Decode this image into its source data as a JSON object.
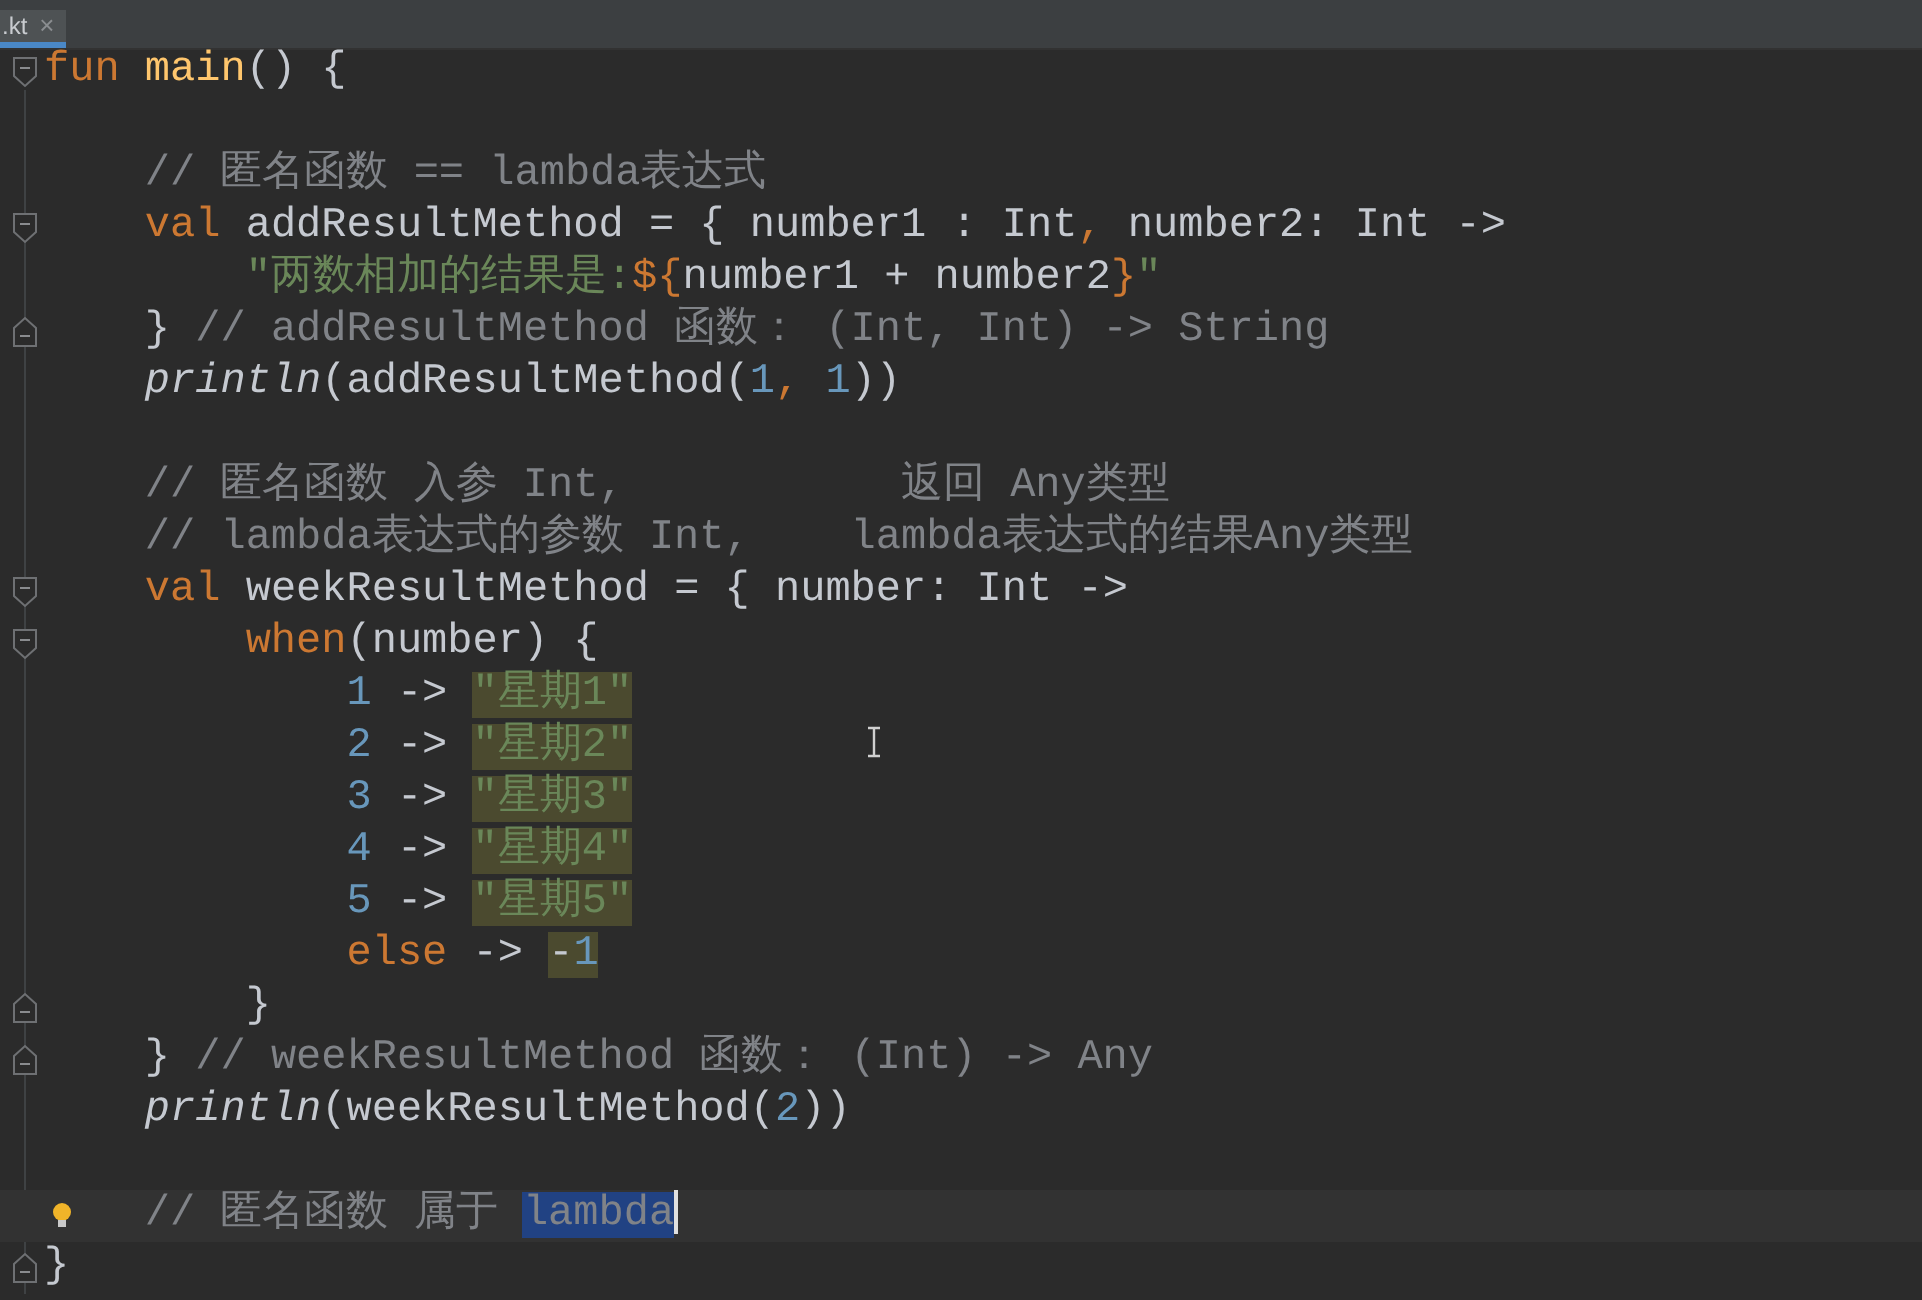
{
  "tab": {
    "label": ".kt",
    "close": "×",
    "selected": true
  },
  "lines": [
    {
      "current": false,
      "gutter": {
        "kind": "fold-open"
      },
      "tokens": [
        {
          "kind": "kw",
          "t": "fun "
        },
        {
          "kind": "fn",
          "t": "main"
        },
        {
          "kind": "p",
          "t": "() {"
        }
      ]
    },
    {
      "current": false,
      "gap_above": true,
      "tokens": [
        {
          "kind": "cm",
          "t": "    // 匿名函数 == lambda表达式"
        }
      ]
    },
    {
      "current": false,
      "gutter": {
        "kind": "fold-open"
      },
      "tokens": [
        {
          "kind": "kw",
          "t": "    val "
        },
        {
          "kind": "p",
          "t": "addResultMethod = { number1 : Int"
        },
        {
          "kind": "comma",
          "t": ","
        },
        {
          "kind": "p",
          "t": " number2: Int ->"
        }
      ]
    },
    {
      "current": false,
      "tokens": [
        {
          "kind": "str",
          "t": "        \"两数相加的结果是:"
        },
        {
          "kind": "tpl",
          "t": "${"
        },
        {
          "kind": "p",
          "t": "number1 + number2"
        },
        {
          "kind": "tpl",
          "t": "}"
        },
        {
          "kind": "str",
          "t": "\""
        }
      ]
    },
    {
      "current": false,
      "gutter": {
        "kind": "fold-close"
      },
      "tokens": [
        {
          "kind": "p",
          "t": "    }"
        },
        {
          "kind": "cm",
          "t": " // addResultMethod 函数： (Int, Int) -> String"
        }
      ]
    },
    {
      "current": false,
      "tokens": [
        {
          "kind": "call",
          "t": "    println"
        },
        {
          "kind": "p",
          "t": "(addResultMethod("
        },
        {
          "kind": "num",
          "t": "1"
        },
        {
          "kind": "comma",
          "t": ","
        },
        {
          "kind": "num",
          "t": " 1"
        },
        {
          "kind": "p",
          "t": "))"
        }
      ]
    },
    {
      "current": false,
      "gap_above": true,
      "tokens": [
        {
          "kind": "cm",
          "t": "    // 匿名函数 入参 Int,           返回 Any类型"
        }
      ]
    },
    {
      "current": false,
      "tokens": [
        {
          "kind": "cm",
          "t": "    // lambda表达式的参数 Int,    lambda表达式的结果Any类型"
        }
      ]
    },
    {
      "current": false,
      "gutter": {
        "kind": "fold-open"
      },
      "tokens": [
        {
          "kind": "kw",
          "t": "    val "
        },
        {
          "kind": "p",
          "t": "weekResultMethod = { number: Int ->"
        }
      ]
    },
    {
      "current": false,
      "gutter": {
        "kind": "fold-open"
      },
      "tokens": [
        {
          "kind": "kw",
          "t": "        when"
        },
        {
          "kind": "p",
          "t": "(number) {"
        }
      ]
    },
    {
      "current": false,
      "tokens": [
        {
          "kind": "num",
          "t": "            1"
        },
        {
          "kind": "p",
          "t": " -> "
        },
        {
          "kind": "str",
          "t": "\"星期1\"",
          "hl": {
            "kind": "match"
          }
        }
      ]
    },
    {
      "current": false,
      "tokens": [
        {
          "kind": "num",
          "t": "            2"
        },
        {
          "kind": "p",
          "t": " -> "
        },
        {
          "kind": "str",
          "t": "\"星期2\"",
          "hl": {
            "kind": "match"
          }
        }
      ]
    },
    {
      "current": false,
      "tokens": [
        {
          "kind": "num",
          "t": "            3"
        },
        {
          "kind": "p",
          "t": " -> "
        },
        {
          "kind": "str",
          "t": "\"星期3\"",
          "hl": {
            "kind": "match"
          }
        }
      ]
    },
    {
      "current": false,
      "tokens": [
        {
          "kind": "num",
          "t": "            4"
        },
        {
          "kind": "p",
          "t": " -> "
        },
        {
          "kind": "str",
          "t": "\"星期4\"",
          "hl": {
            "kind": "match"
          }
        }
      ]
    },
    {
      "current": false,
      "tokens": [
        {
          "kind": "num",
          "t": "            5"
        },
        {
          "kind": "p",
          "t": " -> "
        },
        {
          "kind": "str",
          "t": "\"星期5\"",
          "hl": {
            "kind": "match"
          }
        }
      ]
    },
    {
      "current": false,
      "tokens": [
        {
          "kind": "kw",
          "t": "            else"
        },
        {
          "kind": "p",
          "t": " -> "
        },
        {
          "kind": "p",
          "t": "-",
          "hl": {
            "kind": "match"
          }
        },
        {
          "kind": "num",
          "t": "1",
          "hl": {
            "kind": "match"
          }
        }
      ]
    },
    {
      "current": false,
      "gutter": {
        "kind": "fold-close"
      },
      "tokens": [
        {
          "kind": "p",
          "t": "        }"
        }
      ]
    },
    {
      "current": false,
      "gutter": {
        "kind": "fold-close"
      },
      "tokens": [
        {
          "kind": "p",
          "t": "    }"
        },
        {
          "kind": "cm",
          "t": " // weekResultMethod 函数： (Int) -> Any"
        }
      ]
    },
    {
      "current": false,
      "tokens": [
        {
          "kind": "call",
          "t": "    println"
        },
        {
          "kind": "p",
          "t": "(weekResultMethod("
        },
        {
          "kind": "num",
          "t": "2"
        },
        {
          "kind": "p",
          "t": "))"
        }
      ]
    },
    {
      "current": true,
      "gap_above": true,
      "gutter": {
        "kind": "bulb"
      },
      "tokens": [
        {
          "kind": "cm",
          "t": "    // 匿名函数 属于 "
        },
        {
          "kind": "cm",
          "t": "lambda",
          "hl": {
            "kind": "selection"
          }
        }
      ]
    },
    {
      "current": false,
      "gutter": {
        "kind": "fold-close"
      },
      "tokens": [
        {
          "kind": "p",
          "t": "}"
        }
      ]
    }
  ]
}
